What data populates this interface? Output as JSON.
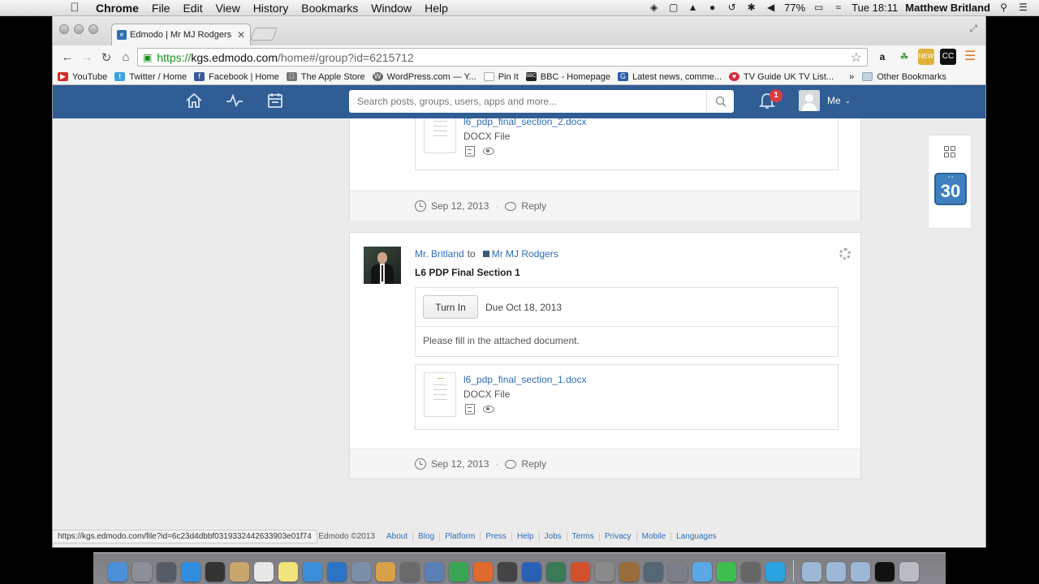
{
  "menubar": {
    "app": "Chrome",
    "menus": [
      "File",
      "Edit",
      "View",
      "History",
      "Bookmarks",
      "Window",
      "Help"
    ],
    "battery": "77%",
    "clock": "Tue 18:11",
    "user": "Matthew Britland"
  },
  "browser": {
    "tab_title": "Edmodo | Mr MJ Rodgers",
    "url_scheme": "https://",
    "url_host": "kgs.edmodo.com",
    "url_path": "/home#/group?id=6215712",
    "status_url": "https://kgs.edmodo.com/file?id=6c23d4dbbf0319332442633903e01f74",
    "bookmarks": [
      {
        "label": "YouTube",
        "color": "#d62b2b",
        "icon": "youtube-icon"
      },
      {
        "label": "Twitter / Home",
        "color": "#3fa2e0",
        "icon": "twitter-icon"
      },
      {
        "label": "Facebook | Home",
        "color": "#3b5998",
        "icon": "facebook-icon"
      },
      {
        "label": "The Apple Store",
        "color": "#777777",
        "icon": "apple-icon"
      },
      {
        "label": "WordPress.com — Y...",
        "color": "#666666",
        "icon": "wordpress-icon"
      },
      {
        "label": "Pin It",
        "color": "#aaaaaa",
        "icon": "page-icon"
      },
      {
        "label": "BBC - Homepage",
        "color": "#222222",
        "icon": "bbc-icon"
      },
      {
        "label": "Latest news, comme...",
        "color": "#2a5ea8",
        "icon": "guardian-icon"
      },
      {
        "label": "TV Guide UK TV List...",
        "color": "#d8273a",
        "icon": "heart-icon"
      }
    ],
    "bookmarks_overflow": "»",
    "other_bookmarks": "Other Bookmarks"
  },
  "edmodo": {
    "search_placeholder": "Search posts, groups, users, apps and more...",
    "notification_count": "1",
    "me_label": "Me",
    "colors": {
      "header": "#2f5d94",
      "link": "#2f6eb5",
      "badge": "#e0393e"
    }
  },
  "posts": [
    {
      "attachment": {
        "filename": "l6_pdp_final_section_2.docx",
        "type": "DOCX File"
      },
      "date": "Sep 12, 2013",
      "reply": "Reply"
    },
    {
      "author": "Mr. Britland",
      "to": "to",
      "group": "Mr MJ Rodgers",
      "title": "L6 PDP Final Section 1",
      "turn_in": "Turn In",
      "due": "Due Oct 18, 2013",
      "description": "Please fill in the attached document.",
      "attachment": {
        "filename": "l6_pdp_final_section_1.docx",
        "type": "DOCX File"
      },
      "date": "Sep 12, 2013",
      "reply": "Reply"
    }
  ],
  "footer": {
    "copyright": "Edmodo ©2013",
    "links": [
      "About",
      "Blog",
      "Platform",
      "Press",
      "Help",
      "Jobs",
      "Terms",
      "Privacy",
      "Mobile",
      "Languages"
    ]
  },
  "calendar_day": "30",
  "dock_apps": [
    {
      "name": "finder-icon",
      "color": "#4d8fd6"
    },
    {
      "name": "launchpad-icon",
      "color": "#8a8f99"
    },
    {
      "name": "mission-control-icon",
      "color": "#555c66"
    },
    {
      "name": "app-store-icon",
      "color": "#2f8ee0"
    },
    {
      "name": "dashboard-icon",
      "color": "#333333"
    },
    {
      "name": "contacts-icon",
      "color": "#c9a66b"
    },
    {
      "name": "calendar-icon",
      "color": "#e8e8e8"
    },
    {
      "name": "notes-icon",
      "color": "#f2e27a"
    },
    {
      "name": "itunes-icon",
      "color": "#3b8fd9"
    },
    {
      "name": "safari-icon",
      "color": "#2b74c4"
    },
    {
      "name": "preview-icon",
      "color": "#7d8fa8"
    },
    {
      "name": "photos-icon",
      "color": "#d9a04a"
    },
    {
      "name": "imovie-icon",
      "color": "#6b6b6b"
    },
    {
      "name": "keynote-icon",
      "color": "#5b7fb5"
    },
    {
      "name": "chrome-icon",
      "color": "#3aa655"
    },
    {
      "name": "firefox-icon",
      "color": "#e06a2b"
    },
    {
      "name": "screenshot-icon",
      "color": "#444444"
    },
    {
      "name": "word-icon",
      "color": "#2b5fb4"
    },
    {
      "name": "time-machine-icon",
      "color": "#3b7a57"
    },
    {
      "name": "powerpoint-icon",
      "color": "#d2502e"
    },
    {
      "name": "utility-icon",
      "color": "#8a8a8a"
    },
    {
      "name": "presenter-icon",
      "color": "#9a6b3b"
    },
    {
      "name": "brush-icon",
      "color": "#556677"
    },
    {
      "name": "system-preferences-icon",
      "color": "#7a7f88"
    },
    {
      "name": "messages-icon",
      "color": "#5aa9e6"
    },
    {
      "name": "spotify-icon",
      "color": "#3fbf4f"
    },
    {
      "name": "apps-icon",
      "color": "#666666"
    },
    {
      "name": "skype-icon",
      "color": "#2aa3e0"
    }
  ],
  "dock_right": [
    {
      "name": "applications-folder-icon",
      "color": "#9cb8d6"
    },
    {
      "name": "documents-folder-icon",
      "color": "#9cb8d6"
    },
    {
      "name": "downloads-folder-icon",
      "color": "#9cb8d6"
    },
    {
      "name": "terminal-icon",
      "color": "#111111"
    },
    {
      "name": "trash-icon",
      "color": "#b9bcc2"
    }
  ]
}
